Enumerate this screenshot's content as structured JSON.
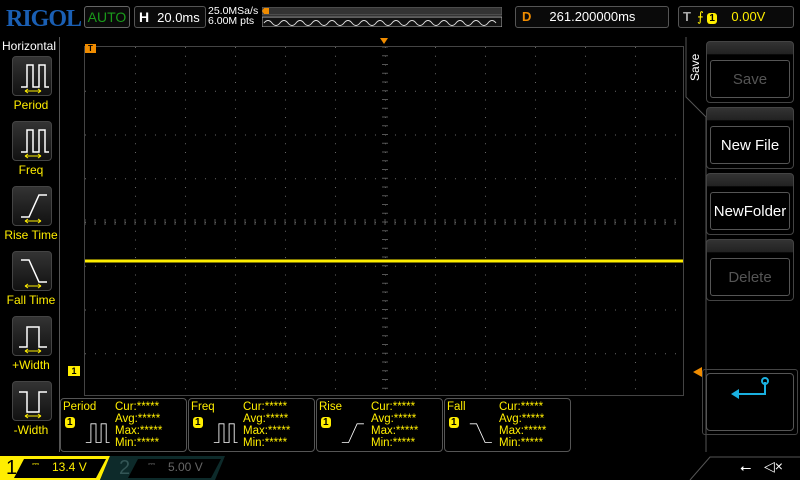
{
  "header": {
    "brand": "RIGOL",
    "mode": "AUTO",
    "timebase_label": "H",
    "timebase": "20.0ms",
    "sample_rate": "25.0MSa/s",
    "memory_depth": "6.00M pts",
    "delay_label": "D",
    "delay": "261.200000ms",
    "trigger_label": "T",
    "trigger_edge": "rising",
    "trigger_source": "1",
    "trigger_level": "0.00V"
  },
  "sidebar": {
    "title": "Horizontal",
    "items": [
      {
        "label": "Period",
        "icon": "period-icon"
      },
      {
        "label": "Freq",
        "icon": "freq-icon"
      },
      {
        "label": "Rise Time",
        "icon": "rise-time-icon"
      },
      {
        "label": "Fall Time",
        "icon": "fall-time-icon"
      },
      {
        "label": "+Width",
        "icon": "positive-width-icon"
      },
      {
        "label": "-Width",
        "icon": "negative-width-icon"
      }
    ]
  },
  "markers": {
    "trigger_pos": "T",
    "ch1_ground": "1"
  },
  "menu": {
    "title": "Save",
    "buttons": [
      {
        "label": "Save",
        "enabled": false
      },
      {
        "label": "New File",
        "enabled": true
      },
      {
        "label": "NewFolder",
        "enabled": true
      },
      {
        "label": "Delete",
        "enabled": false
      }
    ],
    "back_icon": "return-arrow-icon"
  },
  "measurements": [
    {
      "name": "Period",
      "source": "1",
      "cur": "Cur:*****",
      "avg": "Avg:*****",
      "max": "Max:*****",
      "min": "Min:*****"
    },
    {
      "name": "Freq",
      "source": "1",
      "cur": "Cur:*****",
      "avg": "Avg:*****",
      "max": "Max:*****",
      "min": "Min:*****"
    },
    {
      "name": "Rise",
      "source": "1",
      "cur": "Cur:*****",
      "avg": "Avg:*****",
      "max": "Max:*****",
      "min": "Min:*****"
    },
    {
      "name": "Fall",
      "source": "1",
      "cur": "Cur:*****",
      "avg": "Avg:*****",
      "max": "Max:*****",
      "min": "Min:*****"
    }
  ],
  "channels": [
    {
      "num": "1",
      "coupling": "DC",
      "scale": "13.4 V",
      "active": true
    },
    {
      "num": "2",
      "coupling": "DC",
      "scale": "5.00 V",
      "active": false
    }
  ],
  "status": {
    "usb_icon": "usb-icon",
    "sound_icon": "mute-icon"
  },
  "colors": {
    "ch1": "#ffee00",
    "ch2": "#00c0c0",
    "trigger": "#f08c00",
    "accent": "#1a5fb4",
    "auto": "#1a9a1a"
  }
}
